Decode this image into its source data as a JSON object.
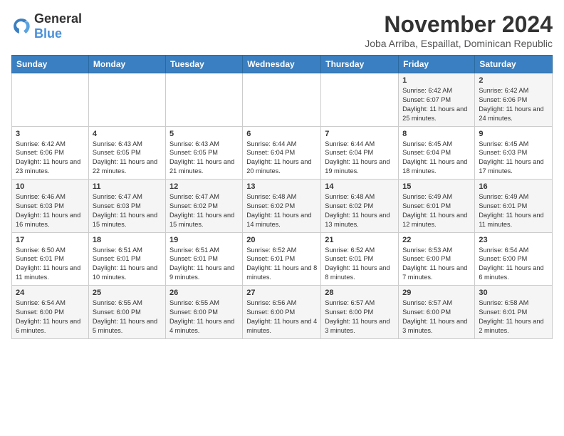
{
  "logo": {
    "text_general": "General",
    "text_blue": "Blue"
  },
  "title": "November 2024",
  "location": "Joba Arriba, Espaillat, Dominican Republic",
  "days_of_week": [
    "Sunday",
    "Monday",
    "Tuesday",
    "Wednesday",
    "Thursday",
    "Friday",
    "Saturday"
  ],
  "weeks": [
    [
      {
        "day": "",
        "sunrise": "",
        "sunset": "",
        "daylight": ""
      },
      {
        "day": "",
        "sunrise": "",
        "sunset": "",
        "daylight": ""
      },
      {
        "day": "",
        "sunrise": "",
        "sunset": "",
        "daylight": ""
      },
      {
        "day": "",
        "sunrise": "",
        "sunset": "",
        "daylight": ""
      },
      {
        "day": "",
        "sunrise": "",
        "sunset": "",
        "daylight": ""
      },
      {
        "day": "1",
        "sunrise": "Sunrise: 6:42 AM",
        "sunset": "Sunset: 6:07 PM",
        "daylight": "Daylight: 11 hours and 25 minutes."
      },
      {
        "day": "2",
        "sunrise": "Sunrise: 6:42 AM",
        "sunset": "Sunset: 6:06 PM",
        "daylight": "Daylight: 11 hours and 24 minutes."
      }
    ],
    [
      {
        "day": "3",
        "sunrise": "Sunrise: 6:42 AM",
        "sunset": "Sunset: 6:06 PM",
        "daylight": "Daylight: 11 hours and 23 minutes."
      },
      {
        "day": "4",
        "sunrise": "Sunrise: 6:43 AM",
        "sunset": "Sunset: 6:05 PM",
        "daylight": "Daylight: 11 hours and 22 minutes."
      },
      {
        "day": "5",
        "sunrise": "Sunrise: 6:43 AM",
        "sunset": "Sunset: 6:05 PM",
        "daylight": "Daylight: 11 hours and 21 minutes."
      },
      {
        "day": "6",
        "sunrise": "Sunrise: 6:44 AM",
        "sunset": "Sunset: 6:04 PM",
        "daylight": "Daylight: 11 hours and 20 minutes."
      },
      {
        "day": "7",
        "sunrise": "Sunrise: 6:44 AM",
        "sunset": "Sunset: 6:04 PM",
        "daylight": "Daylight: 11 hours and 19 minutes."
      },
      {
        "day": "8",
        "sunrise": "Sunrise: 6:45 AM",
        "sunset": "Sunset: 6:04 PM",
        "daylight": "Daylight: 11 hours and 18 minutes."
      },
      {
        "day": "9",
        "sunrise": "Sunrise: 6:45 AM",
        "sunset": "Sunset: 6:03 PM",
        "daylight": "Daylight: 11 hours and 17 minutes."
      }
    ],
    [
      {
        "day": "10",
        "sunrise": "Sunrise: 6:46 AM",
        "sunset": "Sunset: 6:03 PM",
        "daylight": "Daylight: 11 hours and 16 minutes."
      },
      {
        "day": "11",
        "sunrise": "Sunrise: 6:47 AM",
        "sunset": "Sunset: 6:03 PM",
        "daylight": "Daylight: 11 hours and 15 minutes."
      },
      {
        "day": "12",
        "sunrise": "Sunrise: 6:47 AM",
        "sunset": "Sunset: 6:02 PM",
        "daylight": "Daylight: 11 hours and 15 minutes."
      },
      {
        "day": "13",
        "sunrise": "Sunrise: 6:48 AM",
        "sunset": "Sunset: 6:02 PM",
        "daylight": "Daylight: 11 hours and 14 minutes."
      },
      {
        "day": "14",
        "sunrise": "Sunrise: 6:48 AM",
        "sunset": "Sunset: 6:02 PM",
        "daylight": "Daylight: 11 hours and 13 minutes."
      },
      {
        "day": "15",
        "sunrise": "Sunrise: 6:49 AM",
        "sunset": "Sunset: 6:01 PM",
        "daylight": "Daylight: 11 hours and 12 minutes."
      },
      {
        "day": "16",
        "sunrise": "Sunrise: 6:49 AM",
        "sunset": "Sunset: 6:01 PM",
        "daylight": "Daylight: 11 hours and 11 minutes."
      }
    ],
    [
      {
        "day": "17",
        "sunrise": "Sunrise: 6:50 AM",
        "sunset": "Sunset: 6:01 PM",
        "daylight": "Daylight: 11 hours and 11 minutes."
      },
      {
        "day": "18",
        "sunrise": "Sunrise: 6:51 AM",
        "sunset": "Sunset: 6:01 PM",
        "daylight": "Daylight: 11 hours and 10 minutes."
      },
      {
        "day": "19",
        "sunrise": "Sunrise: 6:51 AM",
        "sunset": "Sunset: 6:01 PM",
        "daylight": "Daylight: 11 hours and 9 minutes."
      },
      {
        "day": "20",
        "sunrise": "Sunrise: 6:52 AM",
        "sunset": "Sunset: 6:01 PM",
        "daylight": "Daylight: 11 hours and 8 minutes."
      },
      {
        "day": "21",
        "sunrise": "Sunrise: 6:52 AM",
        "sunset": "Sunset: 6:01 PM",
        "daylight": "Daylight: 11 hours and 8 minutes."
      },
      {
        "day": "22",
        "sunrise": "Sunrise: 6:53 AM",
        "sunset": "Sunset: 6:00 PM",
        "daylight": "Daylight: 11 hours and 7 minutes."
      },
      {
        "day": "23",
        "sunrise": "Sunrise: 6:54 AM",
        "sunset": "Sunset: 6:00 PM",
        "daylight": "Daylight: 11 hours and 6 minutes."
      }
    ],
    [
      {
        "day": "24",
        "sunrise": "Sunrise: 6:54 AM",
        "sunset": "Sunset: 6:00 PM",
        "daylight": "Daylight: 11 hours and 6 minutes."
      },
      {
        "day": "25",
        "sunrise": "Sunrise: 6:55 AM",
        "sunset": "Sunset: 6:00 PM",
        "daylight": "Daylight: 11 hours and 5 minutes."
      },
      {
        "day": "26",
        "sunrise": "Sunrise: 6:55 AM",
        "sunset": "Sunset: 6:00 PM",
        "daylight": "Daylight: 11 hours and 4 minutes."
      },
      {
        "day": "27",
        "sunrise": "Sunrise: 6:56 AM",
        "sunset": "Sunset: 6:00 PM",
        "daylight": "Daylight: 11 hours and 4 minutes."
      },
      {
        "day": "28",
        "sunrise": "Sunrise: 6:57 AM",
        "sunset": "Sunset: 6:00 PM",
        "daylight": "Daylight: 11 hours and 3 minutes."
      },
      {
        "day": "29",
        "sunrise": "Sunrise: 6:57 AM",
        "sunset": "Sunset: 6:00 PM",
        "daylight": "Daylight: 11 hours and 3 minutes."
      },
      {
        "day": "30",
        "sunrise": "Sunrise: 6:58 AM",
        "sunset": "Sunset: 6:01 PM",
        "daylight": "Daylight: 11 hours and 2 minutes."
      }
    ]
  ]
}
